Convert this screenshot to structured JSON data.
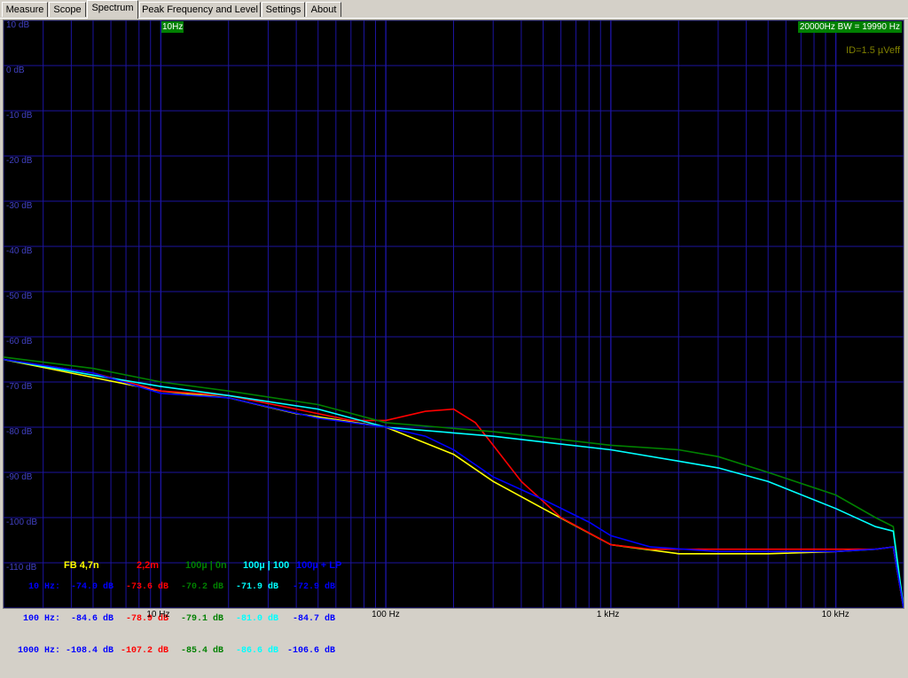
{
  "tabs": [
    {
      "label": "Measure"
    },
    {
      "label": "Scope"
    },
    {
      "label": "Spectrum",
      "active": true
    },
    {
      "label": "Peak Frequency and Level"
    },
    {
      "label": "Settings"
    },
    {
      "label": "About"
    }
  ],
  "plot": {
    "freq_left": "10Hz",
    "freq_right": "20000Hz BW = 19990 Hz",
    "id_text": "ID=1.5 µVeff"
  },
  "colors": {
    "grid": "#1c14a0",
    "ylabel": "#4040c0",
    "yellow": "#ffff00",
    "red": "#ff0000",
    "green": "#008000",
    "cyan": "#00ffff",
    "blue": "#0000ff"
  },
  "legend": [
    {
      "label": "FB 4,7n",
      "color": "#ffff00"
    },
    {
      "label": "2,2m",
      "color": "#ff0000"
    },
    {
      "label": "100µ | 0n",
      "color": "#008000"
    },
    {
      "label": "100µ | 100",
      "color": "#00ffff"
    },
    {
      "label": "100µ + LP",
      "color": "#0000ff"
    }
  ],
  "table": {
    "rows": [
      {
        "label": "10 Hz:",
        "values": [
          "-74.0 dB",
          "-73.6 dB",
          "-70.2 dB",
          "-71.9 dB",
          "-72.9 dB"
        ]
      },
      {
        "label": "100 Hz:",
        "values": [
          "-84.6 dB",
          "-78.9 dB",
          "-79.1 dB",
          "-81.0 dB",
          "-84.7 dB"
        ]
      },
      {
        "label": "1000 Hz:",
        "values": [
          "-108.4 dB",
          "-107.2 dB",
          "-85.4 dB",
          "-86.6 dB",
          "-106.6 dB"
        ]
      }
    ]
  },
  "chart_data": {
    "type": "line",
    "xscale": "log",
    "xlim": [
      2,
      20000
    ],
    "ylim": [
      -120,
      10
    ],
    "grid": true,
    "ylabels": [
      "10 dB",
      "0 dB",
      "-10 dB",
      "-20 dB",
      "-30 dB",
      "-40 dB",
      "-50 dB",
      "-60 dB",
      "-70 dB",
      "-80 dB",
      "-90 dB",
      "-100 dB",
      "-110 dB"
    ],
    "xlabels": [
      {
        "f": 10,
        "label": "10 Hz"
      },
      {
        "f": 100,
        "label": "100 Hz"
      },
      {
        "f": 1000,
        "label": "1 kHz"
      },
      {
        "f": 10000,
        "label": "10 kHz"
      }
    ],
    "series": [
      {
        "name": "FB 4,7n",
        "color": "#ffff00",
        "points": [
          [
            2,
            -65
          ],
          [
            5,
            -69
          ],
          [
            10,
            -72
          ],
          [
            20,
            -73.5
          ],
          [
            40,
            -77
          ],
          [
            100,
            -80
          ],
          [
            200,
            -86
          ],
          [
            300,
            -92
          ],
          [
            500,
            -98
          ],
          [
            1000,
            -106
          ],
          [
            2000,
            -108
          ],
          [
            5000,
            -108
          ],
          [
            10000,
            -107.5
          ],
          [
            15000,
            -107
          ],
          [
            18000,
            -106.5
          ],
          [
            20000,
            -120
          ]
        ]
      },
      {
        "name": "2,2m",
        "color": "#ff0000",
        "points": [
          [
            2,
            -65
          ],
          [
            5,
            -68
          ],
          [
            10,
            -72
          ],
          [
            20,
            -73
          ],
          [
            40,
            -76
          ],
          [
            70,
            -78.5
          ],
          [
            100,
            -78.5
          ],
          [
            150,
            -76.5
          ],
          [
            200,
            -76
          ],
          [
            250,
            -79
          ],
          [
            300,
            -84
          ],
          [
            400,
            -92
          ],
          [
            600,
            -100
          ],
          [
            1000,
            -106
          ],
          [
            1500,
            -107
          ],
          [
            2000,
            -107
          ],
          [
            3000,
            -107
          ],
          [
            5000,
            -107
          ],
          [
            10000,
            -107
          ],
          [
            15000,
            -107
          ],
          [
            18000,
            -106.5
          ],
          [
            20000,
            -120
          ]
        ]
      },
      {
        "name": "100µ | 0n",
        "color": "#008000",
        "points": [
          [
            2,
            -64.5
          ],
          [
            5,
            -67
          ],
          [
            10,
            -70
          ],
          [
            20,
            -72
          ],
          [
            50,
            -75
          ],
          [
            100,
            -79
          ],
          [
            300,
            -81
          ],
          [
            1000,
            -84
          ],
          [
            2000,
            -85
          ],
          [
            3000,
            -86.5
          ],
          [
            5000,
            -90
          ],
          [
            10000,
            -95
          ],
          [
            15000,
            -100
          ],
          [
            18000,
            -102
          ],
          [
            20000,
            -120
          ]
        ]
      },
      {
        "name": "100µ | 100",
        "color": "#00ffff",
        "points": [
          [
            2,
            -65
          ],
          [
            5,
            -68.5
          ],
          [
            10,
            -71
          ],
          [
            20,
            -73
          ],
          [
            50,
            -76
          ],
          [
            100,
            -80
          ],
          [
            300,
            -82
          ],
          [
            1000,
            -85
          ],
          [
            2000,
            -87.5
          ],
          [
            3000,
            -89
          ],
          [
            5000,
            -92
          ],
          [
            10000,
            -98
          ],
          [
            15000,
            -102
          ],
          [
            18000,
            -103
          ],
          [
            20000,
            -120
          ]
        ]
      },
      {
        "name": "100µ + LP",
        "color": "#0000ff",
        "points": [
          [
            2,
            -65
          ],
          [
            5,
            -68
          ],
          [
            10,
            -72.5
          ],
          [
            20,
            -73.5
          ],
          [
            50,
            -78
          ],
          [
            100,
            -80
          ],
          [
            150,
            -82
          ],
          [
            200,
            -85
          ],
          [
            300,
            -91
          ],
          [
            500,
            -96
          ],
          [
            800,
            -101
          ],
          [
            1000,
            -104
          ],
          [
            1500,
            -106.5
          ],
          [
            3000,
            -107.5
          ],
          [
            5000,
            -107.5
          ],
          [
            10000,
            -107.5
          ],
          [
            15000,
            -107
          ],
          [
            18000,
            -106.5
          ],
          [
            20000,
            -120
          ]
        ]
      }
    ]
  }
}
